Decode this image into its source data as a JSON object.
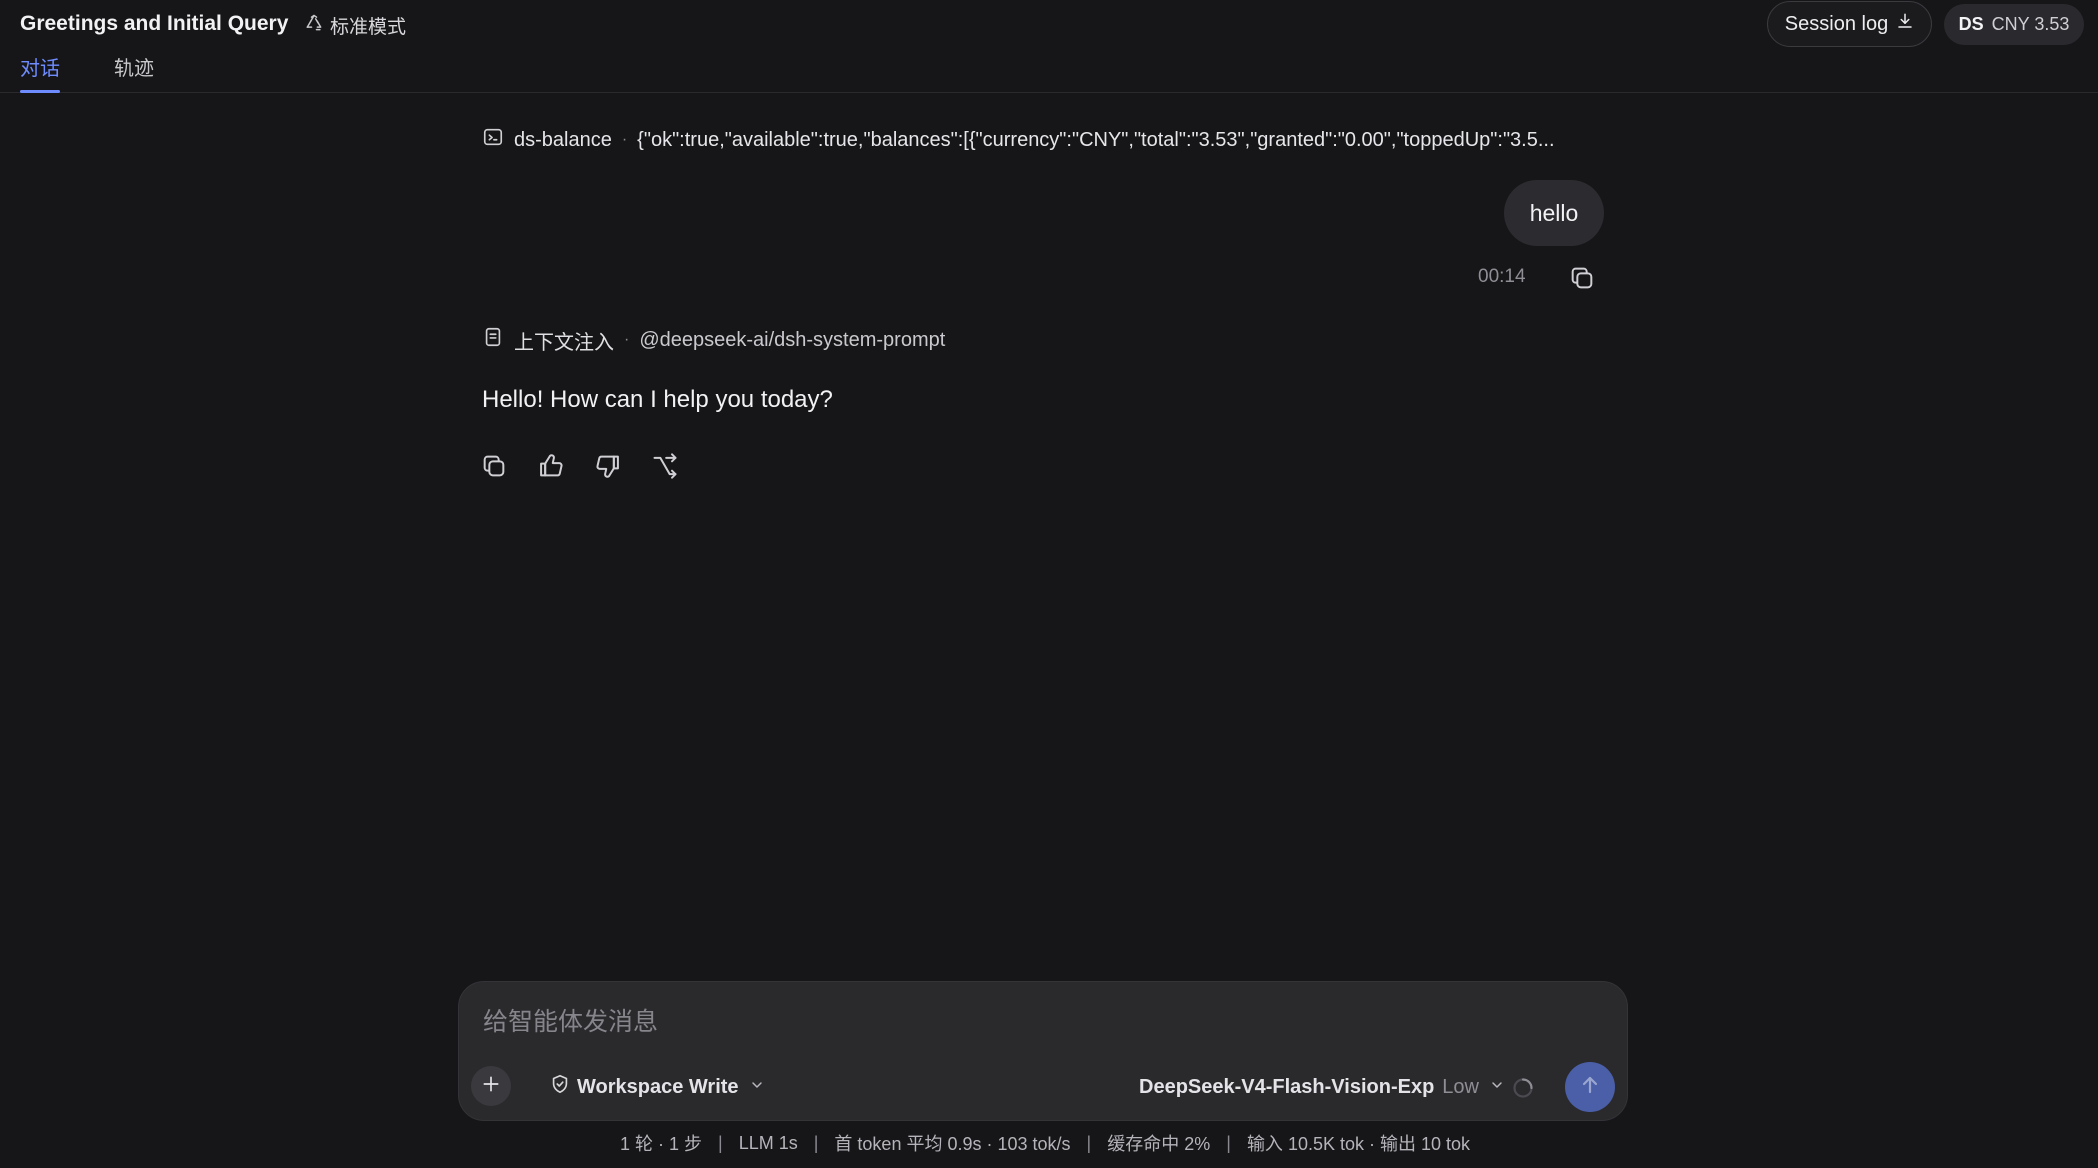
{
  "header": {
    "title": "Greetings and Initial Query",
    "mode_label": "标准模式",
    "tabs": [
      {
        "label": "对话",
        "active": true
      },
      {
        "label": "轨迹",
        "active": false
      }
    ],
    "session_log_label": "Session log",
    "balance": {
      "provider": "DS",
      "amount": "CNY 3.53"
    }
  },
  "conversation": {
    "tool_call": {
      "name": "ds-balance",
      "output": "{\"ok\":true,\"available\":true,\"balances\":[{\"currency\":\"CNY\",\"total\":\"3.53\",\"granted\":\"0.00\",\"toppedUp\":\"3.5..."
    },
    "user_message": {
      "text": "hello",
      "time": "00:14"
    },
    "context_injection": {
      "label": "上下文注入",
      "source": "@deepseek-ai/dsh-system-prompt"
    },
    "assistant_message": {
      "text": "Hello! How can I help you today?"
    }
  },
  "composer": {
    "placeholder": "给智能体发消息",
    "permission_label": "Workspace Write",
    "model_name": "DeepSeek-V4-Flash-Vision-Exp",
    "model_level": "Low"
  },
  "stats": {
    "rounds": "1 轮 · 1 步",
    "llm": "LLM 1s",
    "first_token": "首 token 平均 0.9s · 103 tok/s",
    "cache": "缓存命中 2%",
    "tokens": "输入 10.5K tok · 输出 10 tok"
  },
  "colors": {
    "background": "#161618",
    "accent": "#6f8cff",
    "send_button": "#4a5fa8"
  }
}
